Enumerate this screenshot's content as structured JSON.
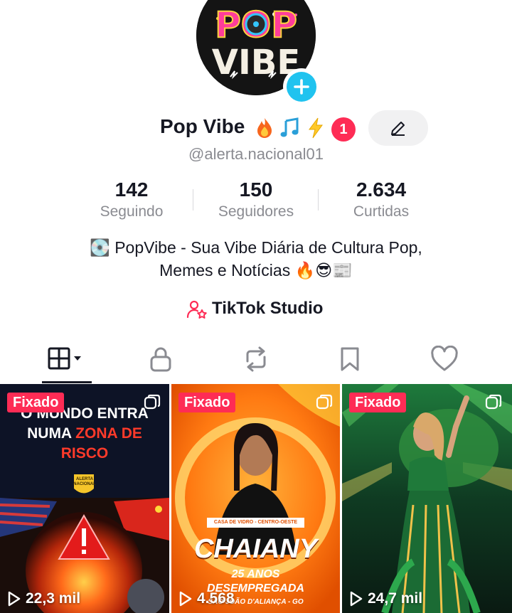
{
  "profile": {
    "avatar_text_top": "POP",
    "avatar_text_bottom": "VIBE",
    "name": "Pop Vibe",
    "name_emojis": [
      "fire-emoji",
      "music-note-emoji",
      "lightning-emoji"
    ],
    "notification_count": "1",
    "username": "@alerta.nacional01"
  },
  "stats": [
    {
      "value": "142",
      "label": "Seguindo"
    },
    {
      "value": "150",
      "label": "Seguidores"
    },
    {
      "value": "2.634",
      "label": "Curtidas"
    }
  ],
  "bio": {
    "line1": "💽 PopVibe - Sua Vibe Diária de Cultura Pop,",
    "line2": "Memes e Notícias 🔥😎📰"
  },
  "studio": {
    "label": "TikTok Studio"
  },
  "tabs": [
    {
      "icon": "grid-icon",
      "active": true
    },
    {
      "icon": "lock-icon"
    },
    {
      "icon": "repost-icon"
    },
    {
      "icon": "bookmark-icon"
    },
    {
      "icon": "heart-icon"
    }
  ],
  "videos": [
    {
      "pinned_label": "Fixado",
      "views": "22,3 mil",
      "text_line1": "O MUNDO ENTRA",
      "text_line2a": "NUMA ",
      "text_line2b": "ZONA DE",
      "text_line3": "RISCO",
      "badge": "ALERTA NACIONAL"
    },
    {
      "pinned_label": "Fixado",
      "views": "4.568",
      "tag": "CASA DE VIDRO - CENTRO-OESTE",
      "title": "CHAIANY",
      "age": "25 ANOS",
      "job": "DESEMPREGADA",
      "place": "SÃO JOÃO D'ALIANÇA - GO"
    },
    {
      "pinned_label": "Fixado",
      "views": "24,7 mil"
    }
  ],
  "colors": {
    "accent": "#fe2c55",
    "add_badge": "#20c3ef",
    "text": "#161823",
    "muted": "#8a8b91"
  }
}
